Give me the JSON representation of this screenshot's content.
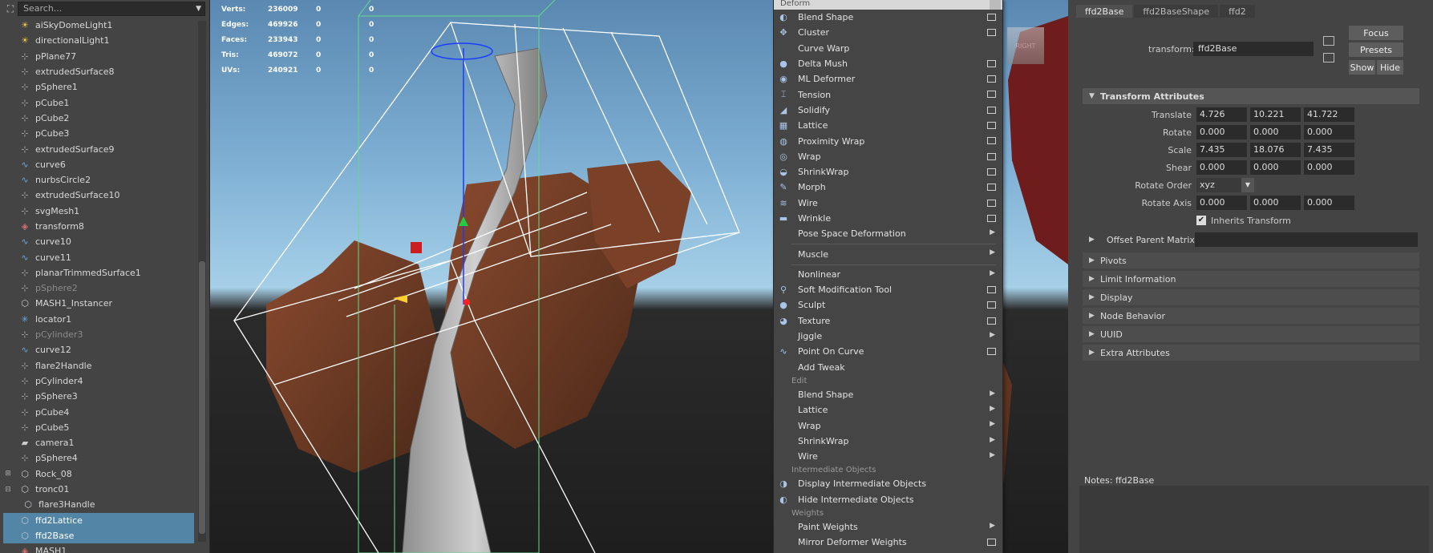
{
  "outliner": {
    "search_placeholder": "Search...",
    "items": [
      {
        "label": "aiSkyDomeLight1",
        "icon": "light-icon",
        "style": "normal",
        "exp": ""
      },
      {
        "label": "directionalLight1",
        "icon": "light-icon",
        "style": "normal",
        "exp": ""
      },
      {
        "label": "pPlane77",
        "icon": "transform-icon",
        "style": "normal",
        "exp": ""
      },
      {
        "label": "extrudedSurface8",
        "icon": "transform-icon",
        "style": "normal",
        "exp": ""
      },
      {
        "label": "pSphere1",
        "icon": "transform-icon",
        "style": "normal",
        "exp": ""
      },
      {
        "label": "pCube1",
        "icon": "transform-icon",
        "style": "normal",
        "exp": ""
      },
      {
        "label": "pCube2",
        "icon": "transform-icon",
        "style": "normal",
        "exp": ""
      },
      {
        "label": "pCube3",
        "icon": "transform-icon",
        "style": "normal",
        "exp": ""
      },
      {
        "label": "extrudedSurface9",
        "icon": "transform-icon",
        "style": "normal",
        "exp": ""
      },
      {
        "label": "curve6",
        "icon": "curve-icon",
        "style": "normal",
        "exp": ""
      },
      {
        "label": "nurbsCircle2",
        "icon": "curve-icon",
        "style": "normal",
        "exp": ""
      },
      {
        "label": "extrudedSurface10",
        "icon": "transform-icon",
        "style": "normal",
        "exp": ""
      },
      {
        "label": "svgMesh1",
        "icon": "transform-icon",
        "style": "normal",
        "exp": ""
      },
      {
        "label": "transform8",
        "icon": "mash-icon",
        "style": "normal",
        "exp": ""
      },
      {
        "label": "curve10",
        "icon": "curve-icon",
        "style": "normal",
        "exp": ""
      },
      {
        "label": "curve11",
        "icon": "curve-icon",
        "style": "normal",
        "exp": ""
      },
      {
        "label": "planarTrimmedSurface1",
        "icon": "transform-icon",
        "style": "normal",
        "exp": ""
      },
      {
        "label": "pSphere2",
        "icon": "transform-icon",
        "style": "dim",
        "exp": ""
      },
      {
        "label": "MASH1_Instancer",
        "icon": "mesh-icon",
        "style": "normal",
        "exp": ""
      },
      {
        "label": "locator1",
        "icon": "locator-icon",
        "style": "normal",
        "exp": ""
      },
      {
        "label": "pCylinder3",
        "icon": "transform-icon",
        "style": "dim",
        "exp": ""
      },
      {
        "label": "curve12",
        "icon": "curve-icon",
        "style": "normal",
        "exp": ""
      },
      {
        "label": "flare2Handle",
        "icon": "transform-icon",
        "style": "normal",
        "exp": ""
      },
      {
        "label": "pCylinder4",
        "icon": "transform-icon",
        "style": "normal",
        "exp": ""
      },
      {
        "label": "pSphere3",
        "icon": "transform-icon",
        "style": "normal",
        "exp": ""
      },
      {
        "label": "pCube4",
        "icon": "transform-icon",
        "style": "normal",
        "exp": ""
      },
      {
        "label": "pCube5",
        "icon": "transform-icon",
        "style": "normal",
        "exp": ""
      },
      {
        "label": "camera1",
        "icon": "camera-icon",
        "style": "normal",
        "exp": ""
      },
      {
        "label": "pSphere4",
        "icon": "transform-icon",
        "style": "normal",
        "exp": ""
      },
      {
        "label": "Rock_08",
        "icon": "mesh-icon",
        "style": "normal",
        "exp": "+"
      },
      {
        "label": "tronc01",
        "icon": "mesh-icon",
        "style": "normal",
        "exp": "-"
      },
      {
        "label": "flare3Handle",
        "icon": "mesh-icon",
        "style": "child",
        "exp": ""
      },
      {
        "label": "ffd2Lattice",
        "icon": "mesh-icon",
        "style": "sel",
        "exp": ""
      },
      {
        "label": "ffd2Base",
        "icon": "mesh-icon",
        "style": "sel",
        "exp": ""
      },
      {
        "label": "MASH1",
        "icon": "mash-icon",
        "style": "normal",
        "exp": ""
      }
    ]
  },
  "hud": {
    "rows": [
      {
        "label": "Verts:",
        "v1": "236009",
        "v2": "0",
        "v3": "0"
      },
      {
        "label": "Edges:",
        "v1": "469926",
        "v2": "0",
        "v3": "0"
      },
      {
        "label": "Faces:",
        "v1": "233943",
        "v2": "0",
        "v3": "0"
      },
      {
        "label": "Tris:",
        "v1": "469072",
        "v2": "0",
        "v3": "0"
      },
      {
        "label": "UVs:",
        "v1": "240921",
        "v2": "0",
        "v3": "0"
      }
    ],
    "view_cube_label": "RIGHT"
  },
  "menu": {
    "title": "Deform",
    "entries": [
      {
        "type": "item",
        "label": "Blend Shape",
        "icon": "blend-shape-icon",
        "trail": "box"
      },
      {
        "type": "item",
        "label": "Cluster",
        "icon": "cluster-icon",
        "trail": "box"
      },
      {
        "type": "item",
        "label": "Curve Warp",
        "icon": "",
        "trail": ""
      },
      {
        "type": "item",
        "label": "Delta Mush",
        "icon": "delta-mush-icon",
        "trail": "box"
      },
      {
        "type": "item",
        "label": "ML Deformer",
        "icon": "ml-deformer-icon",
        "trail": "box"
      },
      {
        "type": "item",
        "label": "Tension",
        "icon": "tension-icon",
        "trail": "box"
      },
      {
        "type": "item",
        "label": "Solidify",
        "icon": "solidify-icon",
        "trail": "box"
      },
      {
        "type": "item",
        "label": "Lattice",
        "icon": "lattice-icon",
        "trail": "box"
      },
      {
        "type": "item",
        "label": "Proximity Wrap",
        "icon": "proximity-wrap-icon",
        "trail": "box"
      },
      {
        "type": "item",
        "label": "Wrap",
        "icon": "wrap-icon",
        "trail": "box"
      },
      {
        "type": "item",
        "label": "ShrinkWrap",
        "icon": "shrinkwrap-icon",
        "trail": "box"
      },
      {
        "type": "item",
        "label": "Morph",
        "icon": "morph-icon",
        "trail": "box"
      },
      {
        "type": "item",
        "label": "Wire",
        "icon": "wire-icon",
        "trail": "box"
      },
      {
        "type": "item",
        "label": "Wrinkle",
        "icon": "wrinkle-icon",
        "trail": "box"
      },
      {
        "type": "item",
        "label": "Pose Space Deformation",
        "icon": "",
        "trail": "arrow"
      },
      {
        "type": "sep"
      },
      {
        "type": "item",
        "label": "Muscle",
        "icon": "",
        "trail": "arrow"
      },
      {
        "type": "sep"
      },
      {
        "type": "item",
        "label": "Nonlinear",
        "icon": "",
        "trail": "arrow"
      },
      {
        "type": "item",
        "label": "Soft Modification Tool",
        "icon": "soft-mod-icon",
        "trail": "box"
      },
      {
        "type": "item",
        "label": "Sculpt",
        "icon": "sculpt-icon",
        "trail": "box"
      },
      {
        "type": "item",
        "label": "Texture",
        "icon": "texture-icon",
        "trail": "box"
      },
      {
        "type": "item",
        "label": "Jiggle",
        "icon": "",
        "trail": "arrow"
      },
      {
        "type": "item",
        "label": "Point On Curve",
        "icon": "point-on-curve-icon",
        "trail": "box"
      },
      {
        "type": "item",
        "label": "Add Tweak",
        "icon": "",
        "trail": ""
      },
      {
        "type": "section",
        "label": "Edit"
      },
      {
        "type": "item",
        "label": "Blend Shape",
        "icon": "",
        "trail": "arrow"
      },
      {
        "type": "item",
        "label": "Lattice",
        "icon": "",
        "trail": "arrow"
      },
      {
        "type": "item",
        "label": "Wrap",
        "icon": "",
        "trail": "arrow"
      },
      {
        "type": "item",
        "label": "ShrinkWrap",
        "icon": "",
        "trail": "arrow"
      },
      {
        "type": "item",
        "label": "Wire",
        "icon": "",
        "trail": "arrow"
      },
      {
        "type": "section",
        "label": "Intermediate Objects"
      },
      {
        "type": "item",
        "label": "Display Intermediate Objects",
        "icon": "display-intermediate-icon",
        "trail": ""
      },
      {
        "type": "item",
        "label": "Hide Intermediate Objects",
        "icon": "hide-intermediate-icon",
        "trail": ""
      },
      {
        "type": "section",
        "label": "Weights"
      },
      {
        "type": "item",
        "label": "Paint Weights",
        "icon": "",
        "trail": "arrow"
      },
      {
        "type": "item",
        "label": "Mirror Deformer Weights",
        "icon": "",
        "trail": "box"
      }
    ]
  },
  "attr": {
    "tabs": [
      "ffd2Base",
      "ffd2BaseShape",
      "ffd2"
    ],
    "transform_label": "transform:",
    "transform_value": "ffd2Base",
    "focus": "Focus",
    "presets": "Presets",
    "show": "Show",
    "hide": "Hide",
    "section_title": "Transform Attributes",
    "translate_label": "Translate",
    "translate": [
      "4.726",
      "10.221",
      "41.722"
    ],
    "rotate_label": "Rotate",
    "rotate": [
      "0.000",
      "0.000",
      "0.000"
    ],
    "scale_label": "Scale",
    "scale": [
      "7.435",
      "18.076",
      "7.435"
    ],
    "shear_label": "Shear",
    "shear": [
      "0.000",
      "0.000",
      "0.000"
    ],
    "rotate_order_label": "Rotate Order",
    "rotate_order": "xyz",
    "rotate_axis_label": "Rotate Axis",
    "rotate_axis": [
      "0.000",
      "0.000",
      "0.000"
    ],
    "inherits_label": "Inherits Transform",
    "offset_parent": "Offset Parent Matrix",
    "collapsed": [
      "Pivots",
      "Limit Information",
      "Display",
      "Node Behavior",
      "UUID",
      "Extra Attributes"
    ],
    "notes_label": "Notes:  ffd2Base"
  }
}
